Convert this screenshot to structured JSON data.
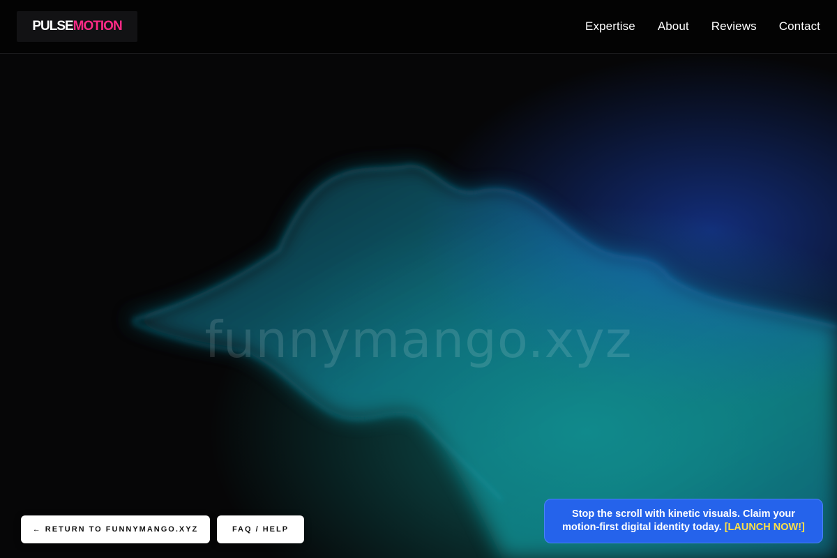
{
  "header": {
    "logo": {
      "part1": "PULSE",
      "part2": "MOTION"
    },
    "nav": [
      "Expertise",
      "About",
      "Reviews",
      "Contact"
    ]
  },
  "hero": {
    "domain": "funnymango.xyz"
  },
  "buttons": {
    "return_label": "← RETURN TO FUNNYMANGO.XYZ",
    "faq_label": "FAQ / HELP"
  },
  "promo": {
    "text": "Stop the scroll with kinetic visuals. Claim your motion-first digital identity today.",
    "cta": "[LAUNCH NOW!]"
  },
  "colors": {
    "brand_accent": "#ff2a86",
    "promo_bg": "#2563eb",
    "cta_yellow": "#fde047"
  }
}
